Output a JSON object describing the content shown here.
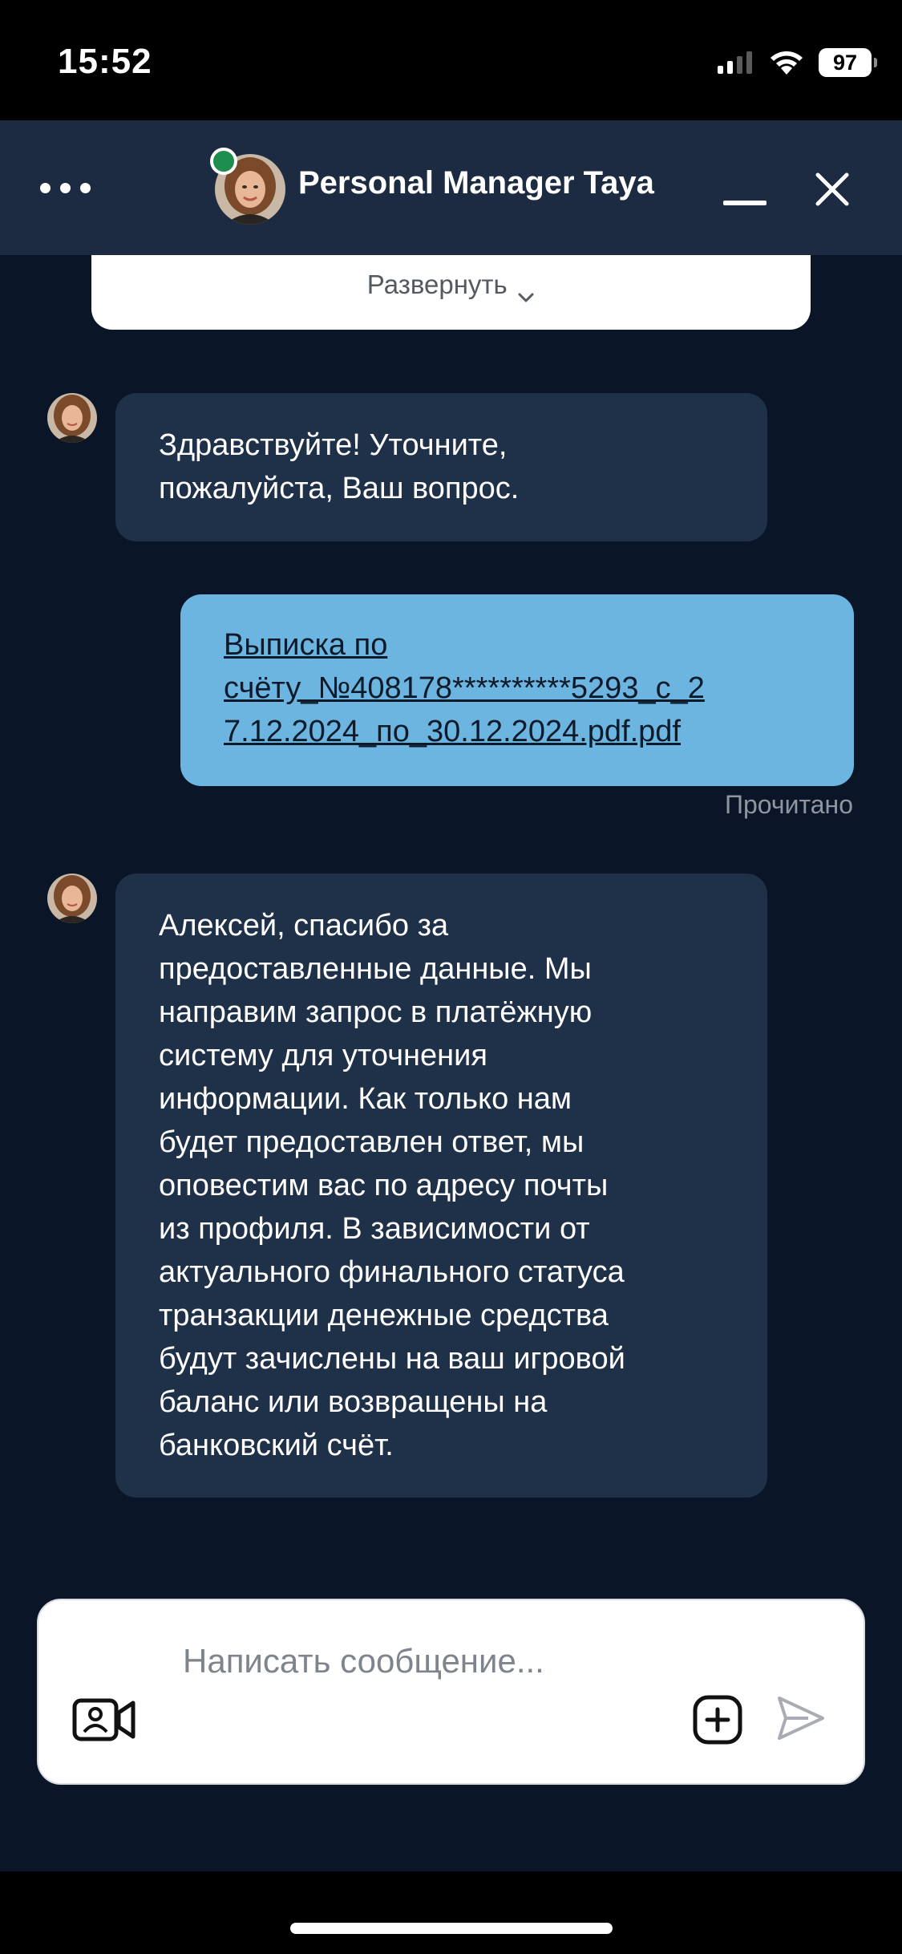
{
  "status_bar": {
    "time": "15:52",
    "battery": "97",
    "signal_icon": "cellular-signal-icon",
    "wifi_icon": "wifi-icon"
  },
  "header": {
    "title": "Personal Manager Taya",
    "more_icon": "more-dots-icon",
    "minimize_icon": "minimize-icon",
    "close_icon": "close-icon",
    "online_color": "#1e8e4e"
  },
  "expand": {
    "label": "Развернуть",
    "icon": "chevron-down-icon"
  },
  "messages": [
    {
      "direction": "incoming",
      "lines": [
        "Здравствуйте! Уточните,",
        "пожалуйста, Ваш вопрос."
      ]
    },
    {
      "direction": "outgoing",
      "file_lines": [
        "Выписка по",
        "счёту_№408178**********5293_с_2",
        "7.12.2024_по_30.12.2024.pdf.pdf"
      ],
      "status": "Прочитано"
    },
    {
      "direction": "incoming",
      "lines": [
        "Алексей, спасибо за",
        "предоставленные данные. Мы",
        "направим запрос в платёжную",
        "систему для уточнения",
        "информации. Как только нам",
        "будет предоставлен ответ, мы",
        "оповестим вас по адресу почты",
        "из профиля. В зависимости от",
        "актуального финального статуса",
        "транзакции денежные средства",
        "будут зачислены на ваш игровой",
        "баланс или возвращены на",
        "банковский счёт."
      ]
    }
  ],
  "composer": {
    "placeholder": "Написать сообщение...",
    "value": "",
    "video_icon": "video-call-icon",
    "attach_icon": "add-attachment-icon",
    "send_icon": "send-icon"
  },
  "colors": {
    "background": "#0a1627",
    "header": "#1c2b42",
    "incoming_bubble": "#1f3049",
    "outgoing_bubble": "#6cb5e0"
  }
}
